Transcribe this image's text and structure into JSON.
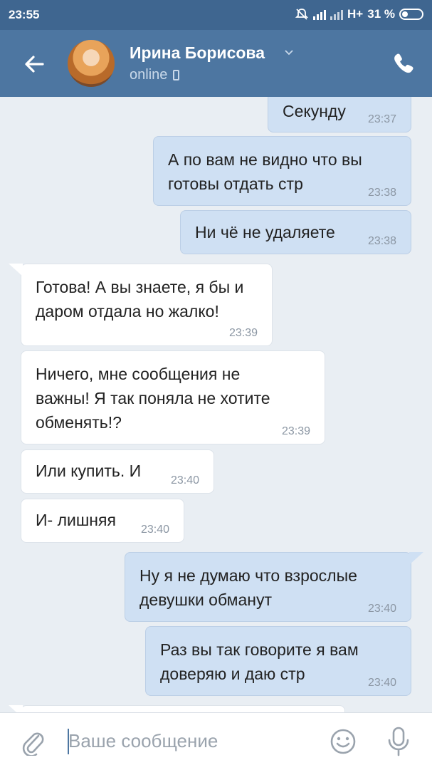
{
  "statusbar": {
    "time": "23:55",
    "network": "H+",
    "battery": "31 %"
  },
  "header": {
    "contact_name": "Ирина Борисова",
    "presence": "online"
  },
  "messages": [
    {
      "dir": "out",
      "text": "Секунду",
      "time": "23:37"
    },
    {
      "dir": "out",
      "text": "А по вам не видно что вы\nготовы отдать стр",
      "time": "23:38"
    },
    {
      "dir": "out",
      "text": "Ни чё не удаляете",
      "time": "23:38"
    },
    {
      "dir": "in",
      "text": "Готова! А вы знаете, я бы и\nдаром отдала но жалко!",
      "time": "23:39"
    },
    {
      "dir": "in",
      "text": "Ничего, мне сообщения не\nважны! Я так поняла не хотите\nобменять!?",
      "time": "23:39"
    },
    {
      "dir": "in",
      "text": "Или купить. И",
      "time": "23:40"
    },
    {
      "dir": "in",
      "text": "И- лишняя",
      "time": "23:40"
    },
    {
      "dir": "out",
      "text": "Ну я не думаю что взрослые\nдевушки обманут",
      "time": "23:40"
    },
    {
      "dir": "out",
      "text": "Раз вы так говорите я вам\nдоверяю и даю стр",
      "time": "23:40"
    }
  ],
  "composer": {
    "placeholder": "Ваше сообщение"
  },
  "icons": {
    "back": "arrow-left-icon",
    "call": "phone-icon",
    "attach": "paperclip-icon",
    "emoji": "smile-icon",
    "mic": "microphone-icon",
    "dropdown": "chevron-down-icon"
  },
  "colors": {
    "header": "#4d76a1",
    "statusbar": "#3f6690",
    "outgoing_bubble": "#cfe0f3",
    "incoming_bubble": "#ffffff",
    "background": "#e9eef3"
  }
}
